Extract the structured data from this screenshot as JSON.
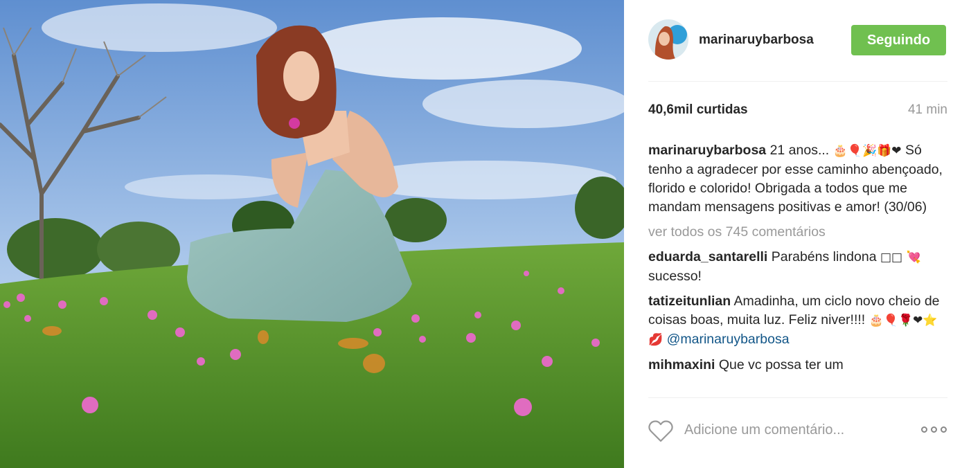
{
  "photo": {
    "alt": ""
  },
  "post": {
    "username": "marinaruybarbosa",
    "follow_label": "Seguindo",
    "likes": "40,6mil curtidas",
    "time": "41 min"
  },
  "caption": {
    "user": "marinaruybarbosa",
    "text": " 21 anos... ",
    "emojis": "🎂🎈🎉🎁❤",
    "text2": " Só tenho a agradecer por esse caminho abençoado, florido e colorido! Obrigada a todos que me mandam mensagens positivas e amor! (30/06)"
  },
  "view_all": "ver todos os 745 comentários",
  "comments": [
    {
      "user": "eduarda_santarelli",
      "text": " Parabéns lindona ",
      "emojis": "□□ 💘",
      "text2": " sucesso!"
    },
    {
      "user": "tatizeitunlian",
      "text": " Amadinha, um ciclo novo cheio de coisas boas, muita luz. Feliz niver!!!! ",
      "emojis": "🎂🎈🌹❤⭐💋",
      "mention": " @marinaruybarbosa"
    },
    {
      "user": "mihmaxini",
      "text": " Que vc possa ter um"
    }
  ],
  "footer": {
    "add_comment_placeholder": "Adicione um comentário..."
  },
  "colors": {
    "follow_button": "#70c050",
    "mention": "#125688",
    "muted": "#999999"
  },
  "icons": [
    "heart-icon",
    "more-options-icon"
  ]
}
